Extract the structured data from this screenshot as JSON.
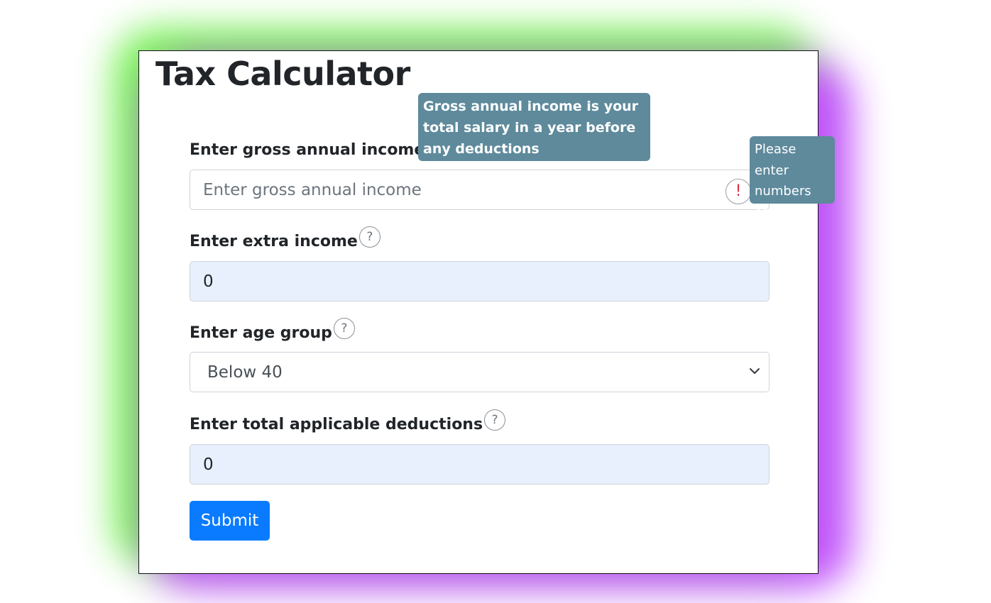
{
  "title": "Tax Calculator",
  "fields": {
    "gross": {
      "label": "Enter gross annual income",
      "placeholder": "Enter gross annual income",
      "value": "",
      "error_icon": "!"
    },
    "extra": {
      "label": "Enter extra income",
      "value": "0"
    },
    "age": {
      "label": "Enter age group",
      "selected": "Below 40"
    },
    "deductions": {
      "label": "Enter total applicable deductions",
      "value": "0"
    }
  },
  "help_glyph": "?",
  "submit_label": "Submit",
  "tooltips": {
    "gross_help": "Gross annual income is your total salary in a year before any deductions",
    "error": "Please enter numbers only"
  },
  "icons": [
    "help-icon",
    "error-icon",
    "chevron-down-icon"
  ],
  "colors": {
    "primary": "#0a7bff",
    "tooltip": "#5e8a9c",
    "error": "#dc3545",
    "autofill": "#e8f0fe"
  }
}
